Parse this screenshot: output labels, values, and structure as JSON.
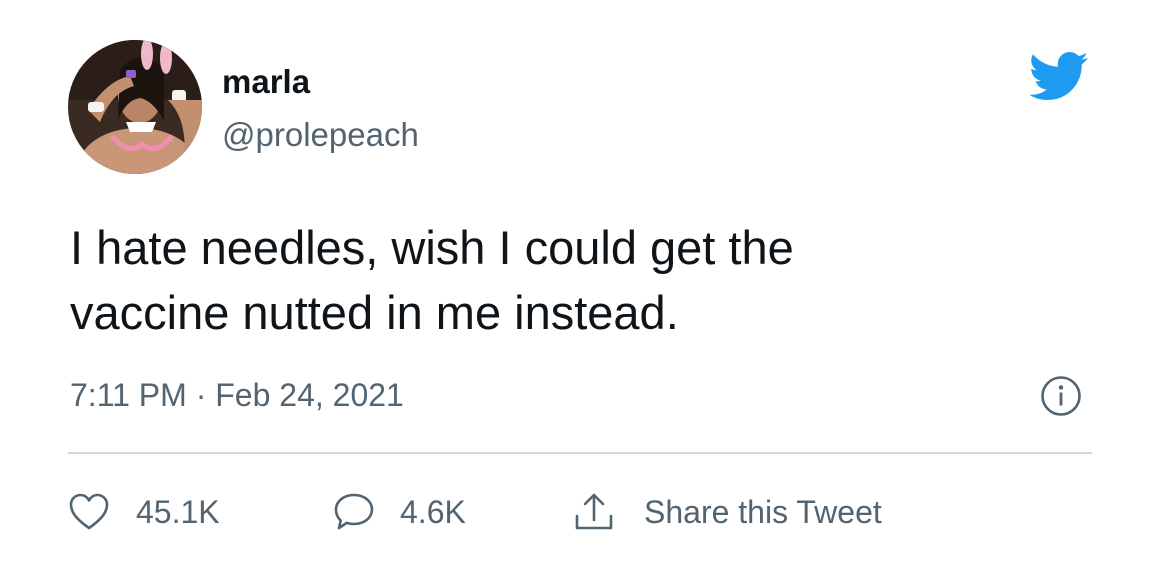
{
  "author": {
    "name": "marla",
    "handle": "@prolepeach"
  },
  "tweet": {
    "line1": "I hate needles, wish I could get the",
    "line2": "vaccine nutted in me instead.",
    "timestamp": "7:11 PM · Feb 24, 2021"
  },
  "actions": {
    "likes": "45.1K",
    "replies": "4.6K",
    "share_label": "Share this Tweet"
  },
  "icons": {
    "brand": "twitter-bird-icon",
    "info": "info-icon",
    "like": "heart-icon",
    "reply": "speech-bubble-icon",
    "share": "share-upload-icon"
  },
  "colors": {
    "brand_blue": "#1d9bf0",
    "text": "#0f1419",
    "secondary_text": "#536471",
    "divider": "#cfd9de"
  }
}
